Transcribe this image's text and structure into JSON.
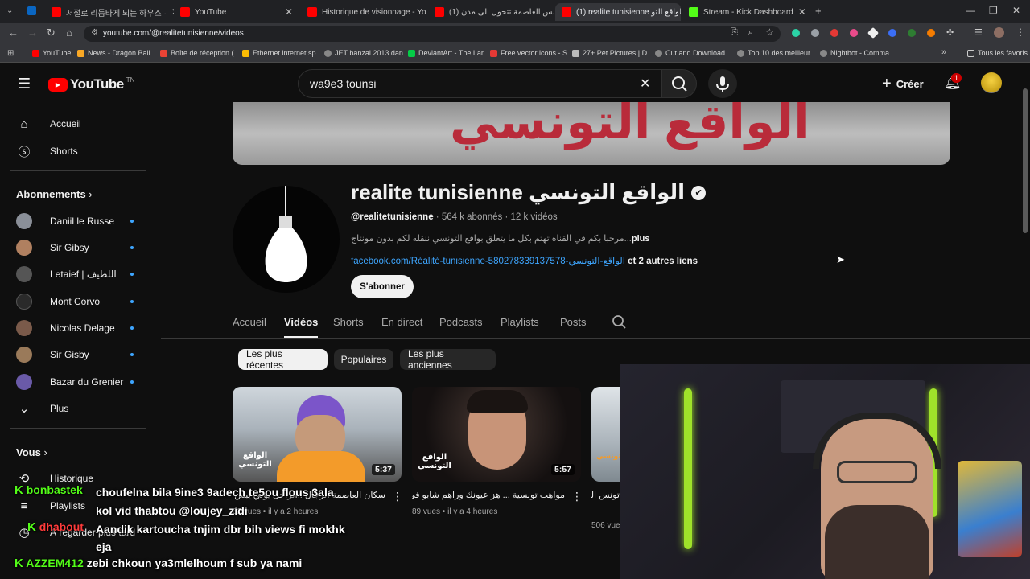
{
  "browser": {
    "tabs": [
      {
        "label": "저절로 리듬타게 되는 하우스 ·",
        "icon": "youtube-icon",
        "active": false
      },
      {
        "label": "YouTube",
        "icon": "youtube-icon",
        "active": false
      },
      {
        "label": "Historique de visionnage - You",
        "icon": "youtube-icon",
        "active": false
      },
      {
        "label": "تونس العاصمة تتحول الى مدن (1)",
        "icon": "youtube-icon",
        "active": false
      },
      {
        "label": "(1) realite tunisienne الواقع التو",
        "icon": "youtube-icon",
        "active": true
      },
      {
        "label": "Stream - Kick Dashboard",
        "icon": "kick-icon",
        "active": false
      }
    ],
    "url": "youtube.com/@realitetunisienne/videos",
    "bookmarks": [
      "YouTube",
      "News - Dragon Ball...",
      "Boîte de réception (...",
      "Ethernet internet sp...",
      "JET banzai 2013 dan...",
      "DeviantArt - The Lar...",
      "Free vector icons - S...",
      "27+ Pet Pictures | D...",
      "Cut and Download...",
      "Top 10 des meilleur...",
      "Nightbot - Comma..."
    ],
    "all_bookmarks": "Tous les favoris"
  },
  "header": {
    "logo": "YouTube",
    "logo_sup": "TN",
    "search_value": "wa9e3 tounsi",
    "create_label": "Créer",
    "notif_count": "1"
  },
  "sidebar": {
    "main": [
      {
        "label": "Accueil",
        "icon": "home-icon"
      },
      {
        "label": "Shorts",
        "icon": "shorts-icon"
      }
    ],
    "subs_title": "Abonnements",
    "subscriptions": [
      {
        "label": "Daniil le Russe",
        "color": "#8a8f98"
      },
      {
        "label": "Sir Gibsy",
        "color": "#b08060"
      },
      {
        "label": "Letaief | اللطيف",
        "color": "#555"
      },
      {
        "label": "Mont Corvo",
        "color": "#222"
      },
      {
        "label": "Nicolas Delage",
        "color": "#7a5a4a"
      },
      {
        "label": "Sir Gisby",
        "color": "#9a7a5a"
      },
      {
        "label": "Bazar du Grenier",
        "color": "#6a5aa8"
      }
    ],
    "more_label": "Plus",
    "you_title": "Vous",
    "you_items": [
      {
        "label": "Historique",
        "icon": "history-icon"
      },
      {
        "label": "Playlists",
        "icon": "playlist-icon"
      },
      {
        "label": "À regarder plus tard",
        "icon": "watch-later-icon"
      }
    ]
  },
  "channel": {
    "banner_text": "الواقع التونسي",
    "name": "realite tunisienne الواقع التونسي",
    "handle": "@realitetunisienne",
    "meta": " · 564 k abonnés · 12 k vidéos",
    "desc": "مرحبا بكم في القناه تهتم بكل ما يتعلق بواقع التونسي ننقله لكم بدون مونتاج...",
    "desc_more": "plus",
    "link": "facebook.com/Réalité-tunisienne-580278339137578-الواقع-التونسي",
    "link_more": " et 2 autres liens",
    "subscribe": "S'abonner",
    "tabs": [
      "Accueil",
      "Vidéos",
      "Shorts",
      "En direct",
      "Podcasts",
      "Playlists",
      "Posts"
    ],
    "active_tab": "Vidéos",
    "chips": [
      "Les plus récentes",
      "Populaires",
      "Les plus anciennes"
    ]
  },
  "videos": [
    {
      "duration": "5:37",
      "title": "سكان العاصمة الرجال ..الراجل يولي يبش",
      "views": "62 vues",
      "age": "il y a 2 heures",
      "thumb_text": "الواقع التونسي"
    },
    {
      "duration": "5:57",
      "title": "مواهب تونسية ... هز عيونك وراهم شابو في",
      "views": "89 vues",
      "age": "il y a 4 heures",
      "thumb_text": "الواقع التونسي"
    },
    {
      "duration": "",
      "title": "تونس العاصمة تتحول الى مدن",
      "views": "506 vues",
      "age": "",
      "thumb_text": "الواقع التونسي"
    }
  ],
  "chat": [
    {
      "user": "bonbastek",
      "user_color": "#53fc18",
      "message": "choufelna bila 9ine3 9adech te5ou flous 3ala kol vid thabtou @loujey_zidi"
    },
    {
      "user": "dhabout",
      "user_color": "#ff3b3b",
      "message": "Aandik kartoucha tnjim dbr bih views fi mokhk eja"
    },
    {
      "user": "AZZEM412",
      "user_color": "#53fc18",
      "message": "zebi chkoun ya3mlelhoum f sub ya nami"
    }
  ],
  "colors": {
    "accent": "#ff0000",
    "link": "#3ea6ff",
    "kick": "#53fc18"
  }
}
